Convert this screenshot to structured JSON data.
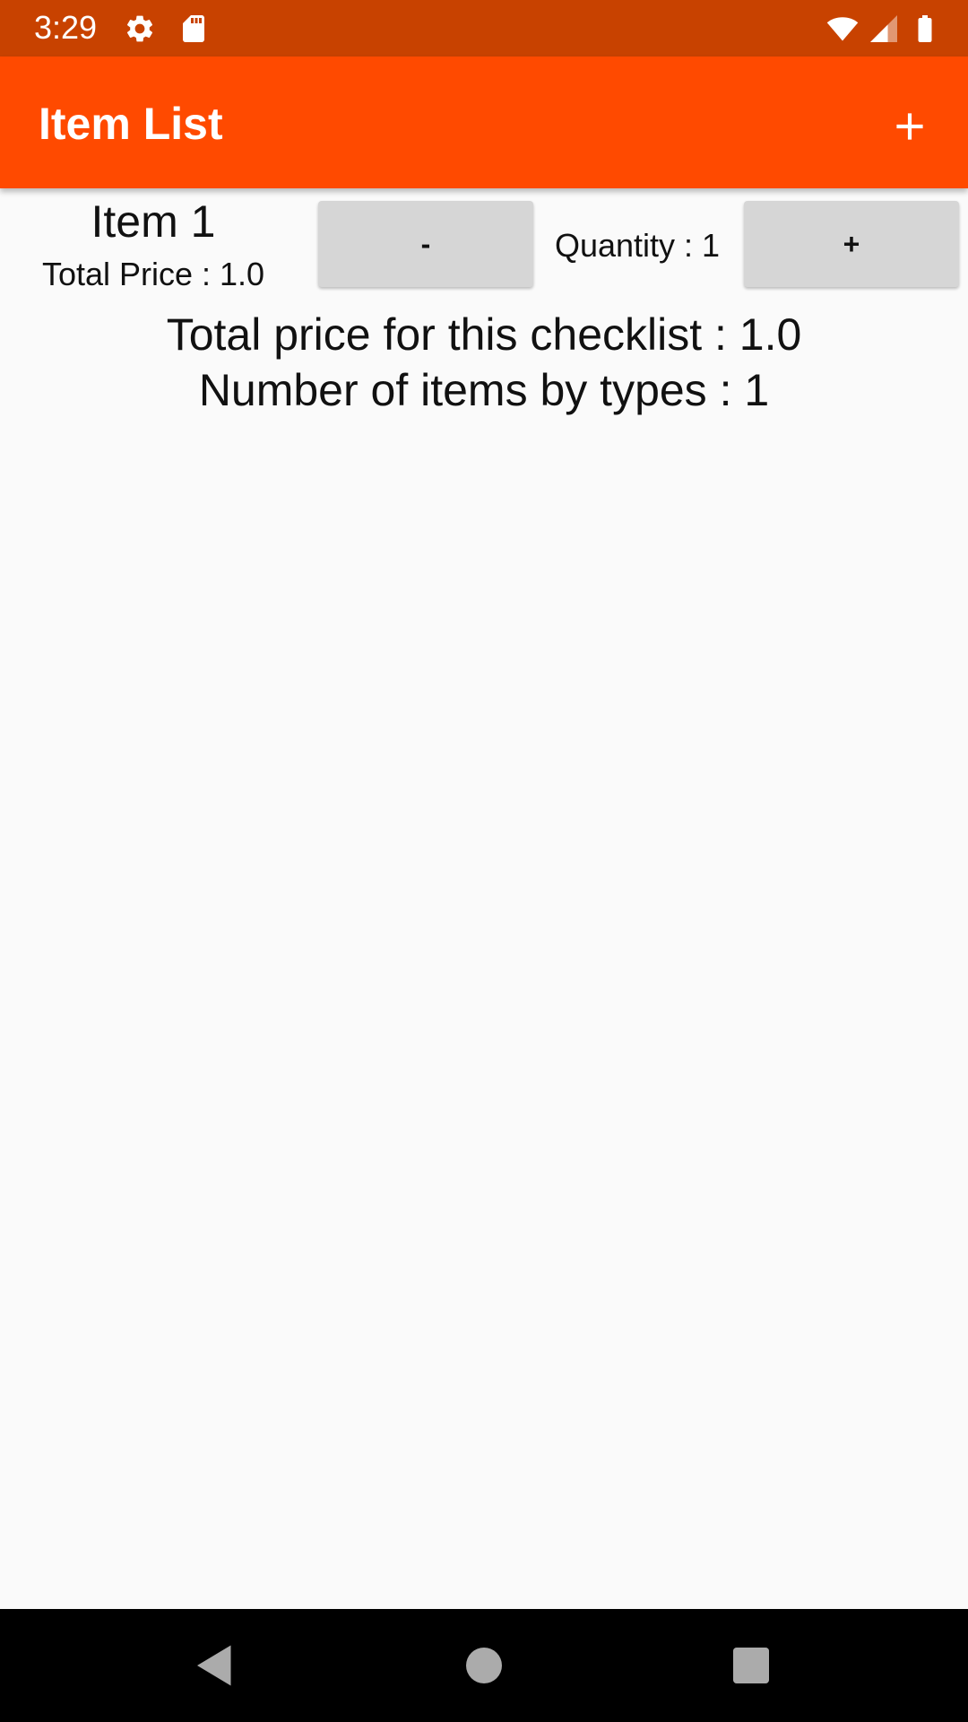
{
  "status_bar": {
    "time": "3:29",
    "icons": [
      "settings-icon",
      "sd-card-icon",
      "wifi-icon",
      "signal-icon",
      "battery-icon"
    ]
  },
  "app_bar": {
    "title": "Item List",
    "action_icon": "add-icon"
  },
  "items": [
    {
      "name": "Item 1",
      "total_price": "Total Price : 1.0",
      "decrement_label": "-",
      "quantity": "Quantity : 1",
      "increment_label": "+"
    }
  ],
  "summary": {
    "total_price": "Total price for this checklist : 1.0",
    "item_count": "Number of items by types : 1"
  },
  "nav_bar": {
    "icons": [
      "back-icon",
      "home-icon",
      "recents-icon"
    ]
  },
  "colors": {
    "status_bar": "#c84200",
    "app_bar": "#ff4a00",
    "button": "#d6d6d6",
    "background": "#fafafa"
  }
}
